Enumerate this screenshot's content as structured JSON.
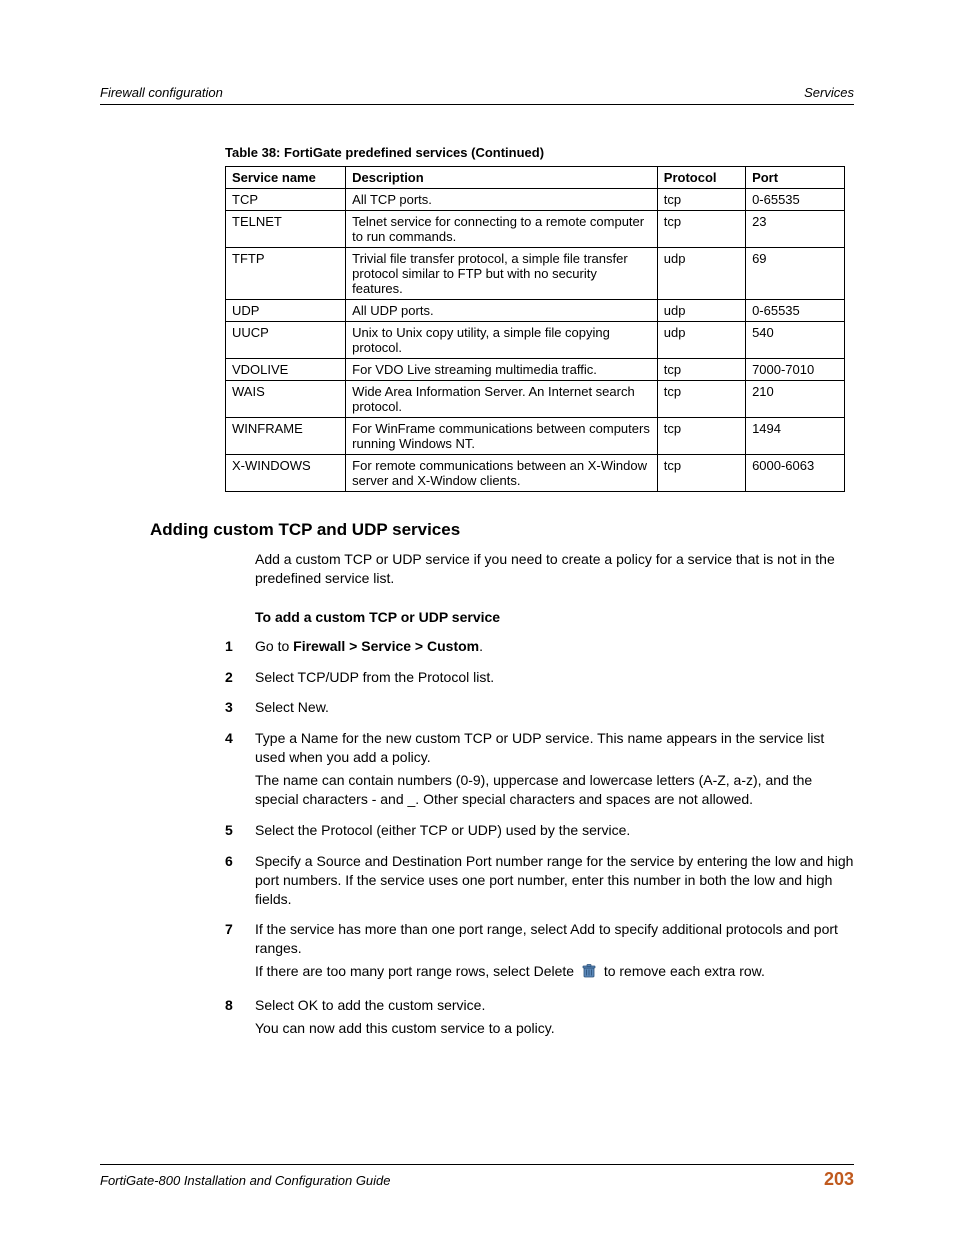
{
  "header": {
    "left": "Firewall configuration",
    "right": "Services"
  },
  "table": {
    "caption": "Table 38: FortiGate predefined services (Continued)",
    "columns": {
      "name": "Service name",
      "desc": "Description",
      "proto": "Protocol",
      "port": "Port"
    },
    "rows": [
      {
        "name": "TCP",
        "desc": "All TCP ports.",
        "proto": "tcp",
        "port": "0-65535"
      },
      {
        "name": "TELNET",
        "desc": "Telnet service for connecting to a remote computer to run commands.",
        "proto": "tcp",
        "port": "23"
      },
      {
        "name": "TFTP",
        "desc": "Trivial file transfer protocol, a simple file transfer protocol similar to FTP but with no security features.",
        "proto": "udp",
        "port": "69"
      },
      {
        "name": "UDP",
        "desc": "All UDP ports.",
        "proto": "udp",
        "port": "0-65535"
      },
      {
        "name": "UUCP",
        "desc": "Unix to Unix copy utility, a simple file copying protocol.",
        "proto": "udp",
        "port": "540"
      },
      {
        "name": "VDOLIVE",
        "desc": "For VDO Live streaming multimedia traffic.",
        "proto": "tcp",
        "port": "7000-7010"
      },
      {
        "name": "WAIS",
        "desc": "Wide Area Information Server. An Internet search protocol.",
        "proto": "tcp",
        "port": "210"
      },
      {
        "name": "WINFRAME",
        "desc": "For WinFrame communications between computers running Windows NT.",
        "proto": "tcp",
        "port": "1494"
      },
      {
        "name": "X-WINDOWS",
        "desc": "For remote communications between an X-Window server and X-Window clients.",
        "proto": "tcp",
        "port": "6000-6063"
      }
    ]
  },
  "section": {
    "title": "Adding custom TCP and UDP services",
    "intro": "Add a custom TCP or UDP service if you need to create a policy for a service that is not in the predefined service list.",
    "subheading": "To add a custom TCP or UDP service",
    "steps": [
      {
        "pre": "Go to ",
        "bold": "Firewall > Service > Custom",
        "post": "."
      },
      {
        "text": "Select TCP/UDP from the Protocol list."
      },
      {
        "text": "Select New."
      },
      {
        "text": "Type a Name for the new custom TCP or UDP service. This name appears in the service list used when you add a policy.",
        "sub": "The name can contain numbers (0-9), uppercase and lowercase letters (A-Z, a-z), and the special characters - and _. Other special characters and spaces are not allowed."
      },
      {
        "text": "Select the Protocol (either TCP or UDP) used by the service."
      },
      {
        "text": "Specify a Source and Destination Port number range for the service by entering the low and high port numbers. If the service uses one port number, enter this number in both the low and high fields."
      },
      {
        "text": "If the service has more than one port range, select Add to specify additional protocols and port ranges.",
        "sub_pre": "If there are too many port range rows, select Delete ",
        "sub_post": " to remove each extra row.",
        "icon": "trash-icon"
      },
      {
        "text": "Select OK to add the custom service.",
        "sub": "You can now add this custom service to a policy."
      }
    ]
  },
  "footer": {
    "left": "FortiGate-800 Installation and Configuration Guide",
    "page": "203"
  }
}
